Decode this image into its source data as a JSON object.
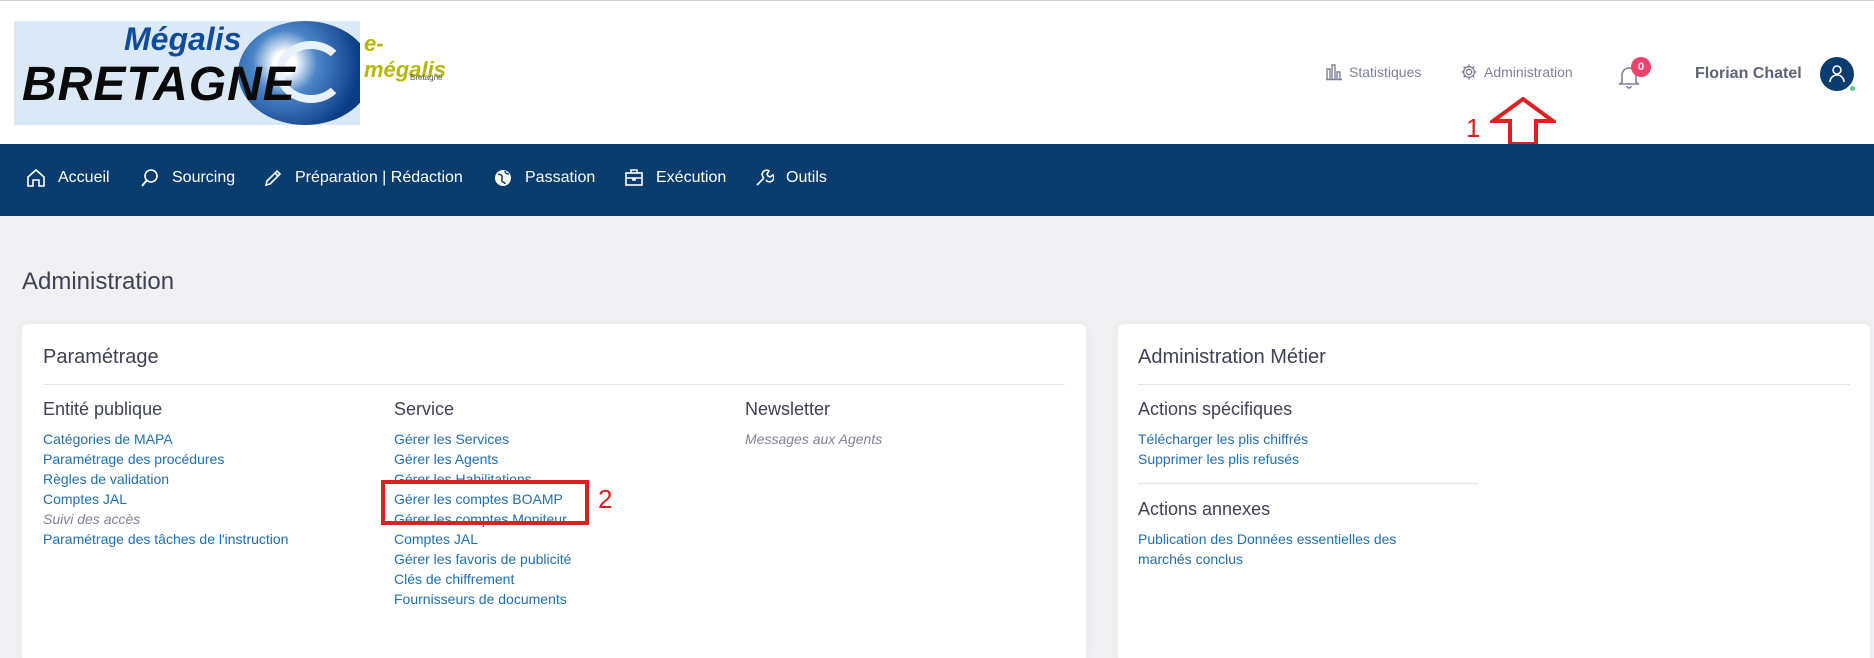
{
  "header": {
    "logo": {
      "title1": "Mégalis",
      "title2": "BRETAGNE",
      "secondary_logo": "e-mégalis",
      "secondary_sub": "Bretagne"
    },
    "top_nav": [
      {
        "label": "Statistiques",
        "icon": "bar-chart-icon"
      },
      {
        "label": "Administration",
        "icon": "gear-icon"
      }
    ],
    "notifications": {
      "count": "0",
      "icon": "bell-icon"
    },
    "user": {
      "name": "Florian Chatel",
      "icon": "user-icon"
    }
  },
  "annotations": {
    "step1": "1",
    "step2": "2"
  },
  "main_nav": [
    {
      "label": "Accueil",
      "icon": "home-icon"
    },
    {
      "label": "Sourcing",
      "icon": "search-icon"
    },
    {
      "label": "Préparation | Rédaction",
      "icon": "pencil-icon"
    },
    {
      "label": "Passation",
      "icon": "globe-icon"
    },
    {
      "label": "Exécution",
      "icon": "briefcase-icon"
    },
    {
      "label": "Outils",
      "icon": "wrench-icon"
    }
  ],
  "page": {
    "title": "Administration"
  },
  "parametrage": {
    "title": "Paramétrage",
    "entite": {
      "title": "Entité publique",
      "links": [
        "Catégories de MAPA",
        "Paramétrage des procédures",
        "Règles de validation",
        "Comptes JAL"
      ],
      "muted": "Suivi des accès",
      "last": "Paramétrage des tâches de l'instruction"
    },
    "service": {
      "title": "Service",
      "links": [
        "Gérer les Services",
        "Gérer les Agents",
        "Gérer les Habilitations",
        "Gérer les comptes BOAMP",
        "Gérer les comptes Moniteur",
        "Comptes JAL",
        "Gérer les favoris de publicité",
        "Clés de chiffrement",
        "Fournisseurs de documents"
      ]
    },
    "newsletter": {
      "title": "Newsletter",
      "muted": "Messages aux Agents"
    }
  },
  "metier": {
    "title": "Administration Métier",
    "specifiques": {
      "title": "Actions spécifiques",
      "links": [
        "Télécharger les plis chiffrés",
        "Supprimer les plis refusés"
      ]
    },
    "annexes": {
      "title": "Actions annexes",
      "link_line1": "Publication des Données essentielles des",
      "link_line2": "marchés conclus"
    }
  },
  "colors": {
    "nav_bg": "#0a3c6e",
    "link": "#1f6fb2",
    "annotation": "#e02020",
    "badge": "#f1416c"
  }
}
